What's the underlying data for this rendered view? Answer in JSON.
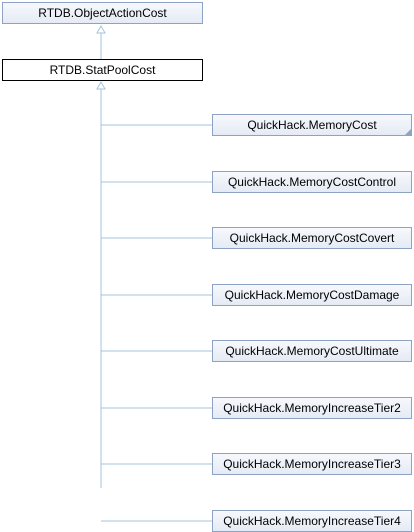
{
  "diagram": {
    "base_class": "RTDB.ObjectActionCost",
    "current_class": "RTDB.StatPoolCost",
    "derived_classes": [
      "QuickHack.MemoryCost",
      "QuickHack.MemoryCostControl",
      "QuickHack.MemoryCostCovert",
      "QuickHack.MemoryCostDamage",
      "QuickHack.MemoryCostUltimate",
      "QuickHack.MemoryIncreaseTier2",
      "QuickHack.MemoryIncreaseTier3",
      "QuickHack.MemoryIncreaseTier4"
    ]
  },
  "colors": {
    "connector": "#a7c2dd",
    "node_border": "#8ea2c4",
    "node_fill_top": "#f6f8fc",
    "node_fill_bottom": "#e5ebf5",
    "current_border": "#000000"
  }
}
